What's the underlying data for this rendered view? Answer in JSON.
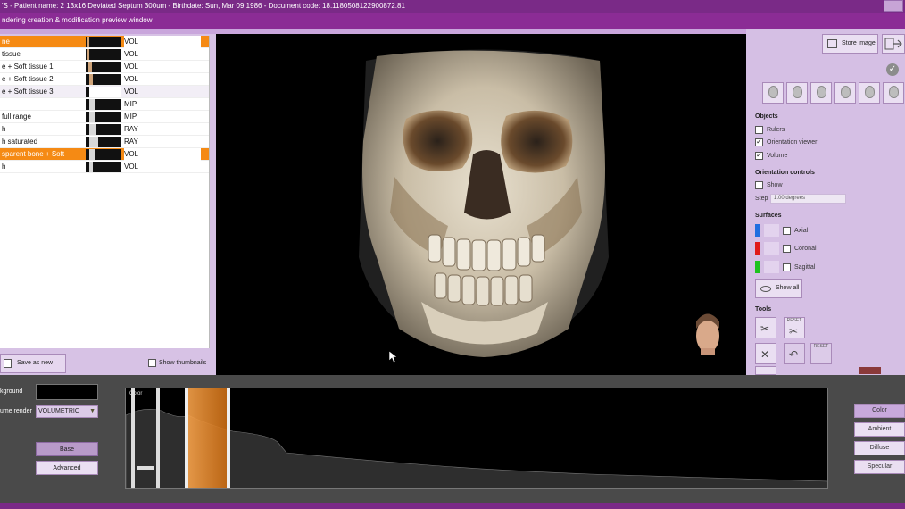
{
  "titlebar": {
    "text": "'S - Patient name: 2 13x16 Deviated Septum 300um - Birthdate: Sun, Mar 09 1986 - Document code: 18.1180508122900872.81"
  },
  "subtitlebar": {
    "text": "ndering creation & modification preview window"
  },
  "presets": [
    {
      "name": "ne",
      "type": "VOL",
      "highlight": true
    },
    {
      "name": " tissue",
      "type": "VOL"
    },
    {
      "name": "e + Soft tissue 1",
      "type": "VOL"
    },
    {
      "name": "e + Soft tissue 2",
      "type": "VOL"
    },
    {
      "name": "e + Soft tissue 3",
      "type": "VOL",
      "selected": true
    },
    {
      "name": "",
      "type": "MIP"
    },
    {
      "name": " full range",
      "type": "MIP"
    },
    {
      "name": "h",
      "type": "RAY"
    },
    {
      "name": "h saturated",
      "type": "RAY"
    },
    {
      "name": "sparent bone + Soft",
      "type": "VOL",
      "highlight": true
    },
    {
      "name": "h",
      "type": "VOL"
    }
  ],
  "left": {
    "save_label": "Save as new",
    "show_thumbnails_label": "Show thumbnails",
    "show_thumbnails_checked": false
  },
  "right": {
    "store_image_label": "Store image",
    "objects_title": "Objects",
    "rulers_label": "Rulers",
    "rulers_checked": false,
    "orientation_viewer_label": "Orientation viewer",
    "orientation_viewer_checked": true,
    "volume_label": "Volume",
    "volume_checked": true,
    "orientation_controls_title": "Orientation controls",
    "show_label": "Show",
    "show_checked": false,
    "step_label": "Step",
    "step_value": "1.00 degrees",
    "surfaces_title": "Surfaces",
    "surfaces": [
      {
        "label": "Axial",
        "color": "#1f6fe0"
      },
      {
        "label": "Coronal",
        "color": "#e01a1a"
      },
      {
        "label": "Sagittal",
        "color": "#1ec21e"
      }
    ],
    "show_all_label": "Show all",
    "tools_title": "Tools",
    "reset_label": "RESET"
  },
  "bottom": {
    "background_label": "kground",
    "volume_render_label": "ume render",
    "volume_render_value": "VOLUMETRIC",
    "base_label": "Base",
    "advanced_label": "Advanced",
    "histogram_label": "Color",
    "color_btn": "Color",
    "ambient_btn": "Ambient",
    "diffuse_btn": "Diffuse",
    "specular_btn": "Specular"
  },
  "colors": {
    "title_purple": "#7a2a87",
    "panel_lilac": "#d5bfe4",
    "highlight_orange": "#f58a14"
  }
}
